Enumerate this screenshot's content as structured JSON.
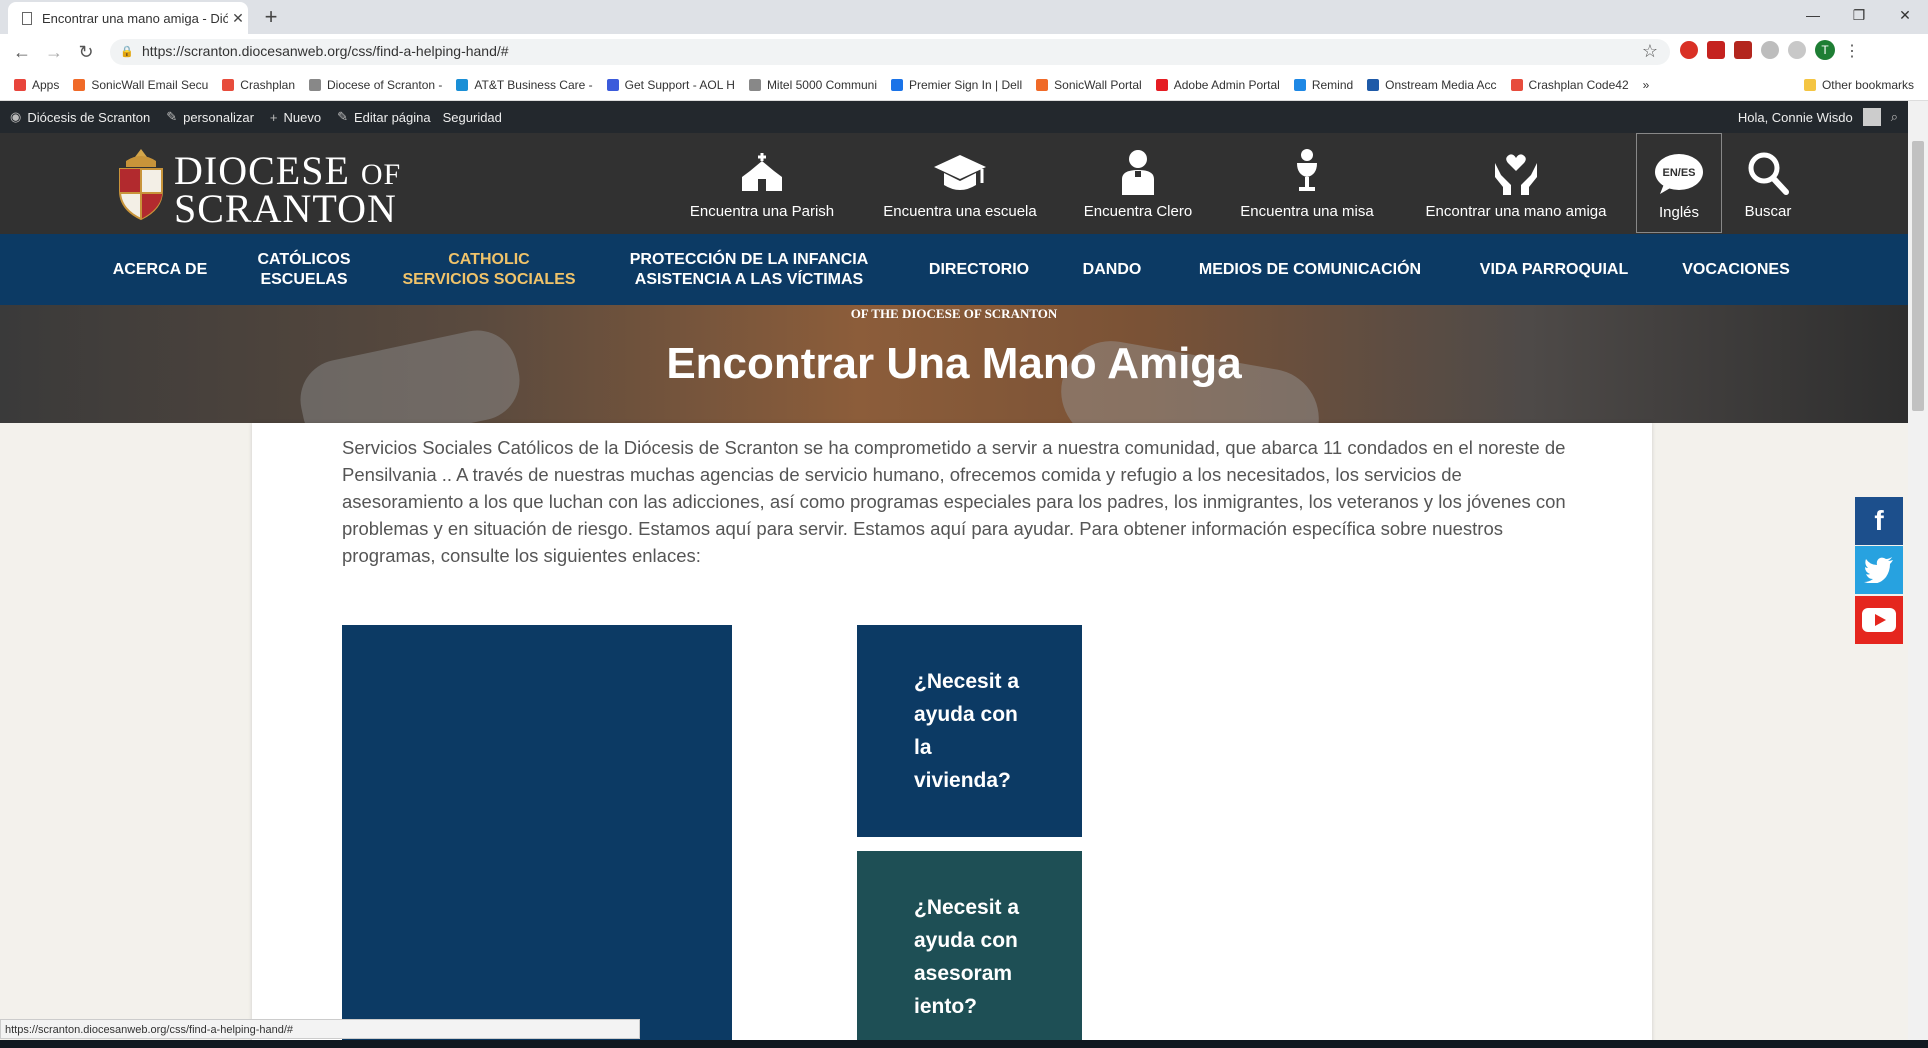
{
  "browser": {
    "tab_title": "Encontrar una mano amiga - Dió",
    "url": "https://scranton.diocesanweb.org/css/find-a-helping-hand/#",
    "window_controls": [
      "—",
      "❐",
      "✕"
    ],
    "bookmarks": [
      {
        "label": "Apps",
        "color": "#e8453c"
      },
      {
        "label": "SonicWall Email Secu",
        "color": "#f06a28"
      },
      {
        "label": "Crashplan",
        "color": "#e74c3c"
      },
      {
        "label": "Diocese of Scranton -",
        "color": "#888888"
      },
      {
        "label": "AT&T Business Care -",
        "color": "#1a8fd6"
      },
      {
        "label": "Get Support - AOL H",
        "color": "#3b5bdb"
      },
      {
        "label": "Mitel 5000 Communi",
        "color": "#888888"
      },
      {
        "label": "Premier Sign In | Dell",
        "color": "#1a73e8"
      },
      {
        "label": "SonicWall Portal",
        "color": "#f06a28"
      },
      {
        "label": "Adobe Admin Portal",
        "color": "#e51c23"
      },
      {
        "label": "Remind",
        "color": "#1e88e5"
      },
      {
        "label": "Onstream Media Acc",
        "color": "#1e5aa8"
      },
      {
        "label": "Crashplan Code42",
        "color": "#e74c3c"
      },
      {
        "label": "»",
        "color": ""
      },
      {
        "label": "Other bookmarks",
        "color": "#f4c542"
      }
    ],
    "status_url": "https://scranton.diocesanweb.org/css/find-a-helping-hand/#"
  },
  "adminbar": {
    "site": "Diócesis de Scranton",
    "customize": "personalizar",
    "new": "Nuevo",
    "edit": "Editar página",
    "security": "Seguridad",
    "greeting": "Hola, Connie Wisdo"
  },
  "header": {
    "logo_line1": "DIOCESE",
    "logo_of": "OF",
    "logo_line2": "SCRANTON",
    "icons": [
      {
        "label": "Encuentra una Parish",
        "icon": "church-icon"
      },
      {
        "label": "Encuentra una escuela",
        "icon": "graduation-cap-icon"
      },
      {
        "label": "Encuentra Clero",
        "icon": "clergy-icon"
      },
      {
        "label": "Encuentra una misa",
        "icon": "chalice-icon"
      },
      {
        "label": "Encontrar una mano amiga",
        "icon": "helping-hands-icon"
      },
      {
        "label": "Inglés",
        "icon": "language-bubble-icon",
        "badge": "EN/ES"
      },
      {
        "label": "Buscar",
        "icon": "search-icon"
      }
    ]
  },
  "nav": [
    {
      "line1": "ACERCA DE",
      "line2": ""
    },
    {
      "line1": "CATÓLICOS",
      "line2": "ESCUELAS"
    },
    {
      "line1": "CATHOLIC",
      "line2": "SERVICIOS SOCIALES",
      "active": true
    },
    {
      "line1": "PROTECCIÓN DE LA INFANCIA",
      "line2": "ASISTENCIA A LAS VÍCTIMAS"
    },
    {
      "line1": "DIRECTORIO",
      "line2": ""
    },
    {
      "line1": "DANDO",
      "line2": ""
    },
    {
      "line1": "MEDIOS DE COMUNICACIÓN",
      "line2": ""
    },
    {
      "line1": "VIDA PARROQUIAL",
      "line2": ""
    },
    {
      "line1": "VOCACIONES",
      "line2": ""
    }
  ],
  "hero": {
    "subtitle": "OF THE DIOCESE OF SCRANTON",
    "title": "Encontrar Una Mano Amiga"
  },
  "content": {
    "intro": "Servicios Sociales Católicos de la Diócesis de Scranton se ha comprometido a servir a nuestra comunidad, que abarca 11 condados en el noreste de Pensilvania .. A través de nuestras muchas agencias de servicio humano, ofrecemos comida y refugio a los necesitados, los servicios de asesoramiento a los que luchan con las adicciones, así como programas especiales para los padres, los inmigrantes, los veteranos y los jóvenes con problemas y en situación de riesgo. Estamos aquí para servir. Estamos aquí para ayudar. Para obtener información específica sobre nuestros programas, consulte los siguientes enlaces:",
    "cards": [
      {
        "text": "¿Necesit a ayuda con la vivienda?"
      },
      {
        "text": "¿Necesit a ayuda con asesoram iento?"
      }
    ]
  },
  "social": [
    {
      "name": "facebook",
      "glyph": "f",
      "color": "#1c4f8c"
    },
    {
      "name": "twitter",
      "glyph": "🐦",
      "color": "#27a2e0"
    },
    {
      "name": "youtube",
      "glyph": "▶",
      "color": "#e5261e"
    }
  ],
  "colors": {
    "header_bg": "#313131",
    "nav_bg": "#0c3a64",
    "nav_active": "#f0c36a",
    "card_teal": "#1e4f55"
  }
}
